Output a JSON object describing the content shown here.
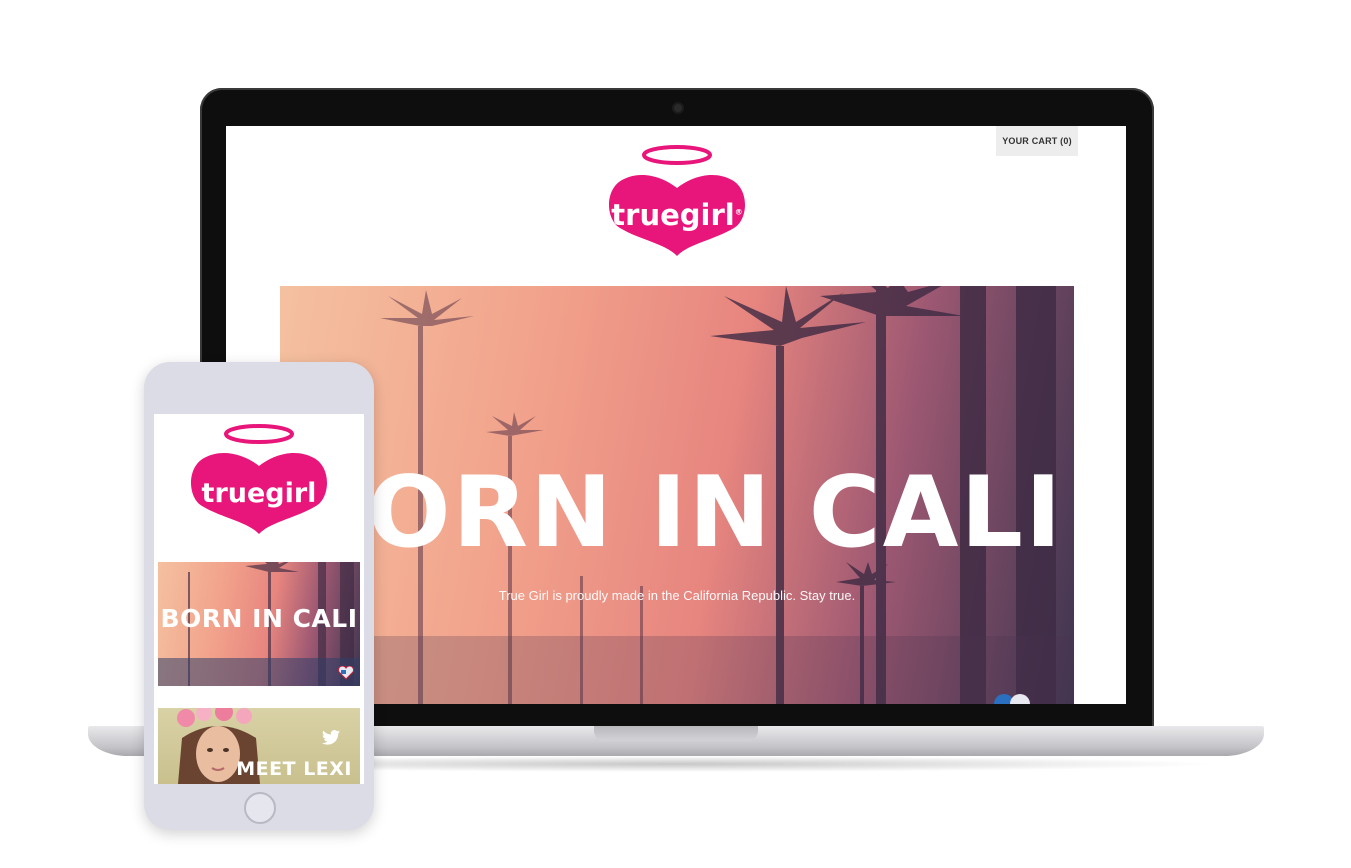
{
  "site": {
    "cart_label": "YOUR CART (0)",
    "logo_text": "truegirl",
    "logo_registered": "®",
    "brand_color": "#e8157a"
  },
  "hero": {
    "title": "BORN IN CALI",
    "subtitle": "True Girl is proudly made in the California Republic. Stay true."
  },
  "mobile": {
    "logo_text": "truegirl",
    "hero_title": "BORN IN CALI",
    "feature_title": "MEET LEXI",
    "feature_icon": "twitter-icon"
  }
}
